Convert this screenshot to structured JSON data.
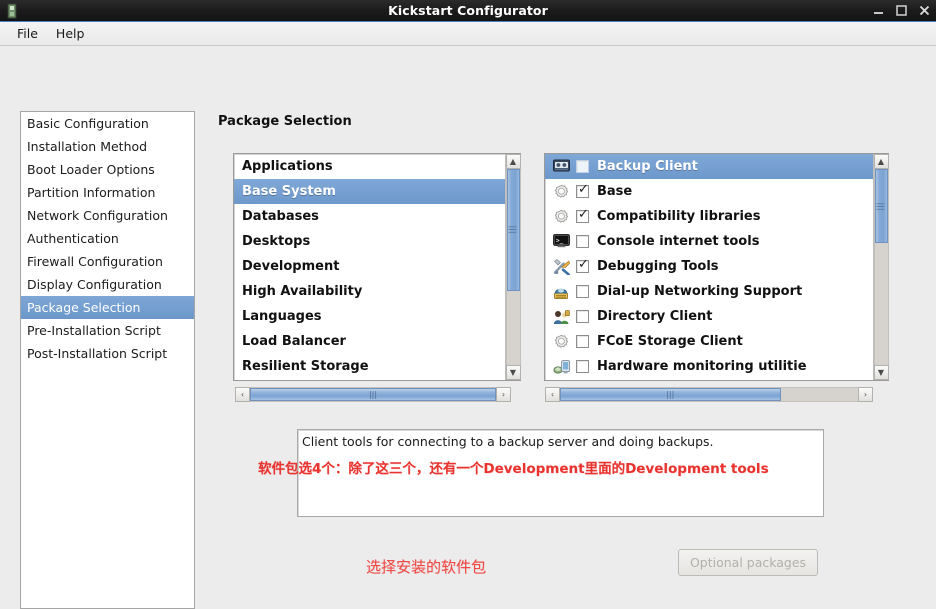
{
  "window": {
    "title": "Kickstart Configurator",
    "app_icon": "app-icon",
    "controls": {
      "minimize": "—",
      "maximize": "□",
      "close": "✕"
    }
  },
  "menubar": {
    "items": [
      {
        "label": "File"
      },
      {
        "label": "Help"
      }
    ]
  },
  "sidebar": {
    "items": [
      {
        "label": "Basic Configuration",
        "selected": false
      },
      {
        "label": "Installation Method",
        "selected": false
      },
      {
        "label": "Boot Loader Options",
        "selected": false
      },
      {
        "label": "Partition Information",
        "selected": false
      },
      {
        "label": "Network Configuration",
        "selected": false
      },
      {
        "label": "Authentication",
        "selected": false
      },
      {
        "label": "Firewall Configuration",
        "selected": false
      },
      {
        "label": "Display Configuration",
        "selected": false
      },
      {
        "label": "Package Selection",
        "selected": true
      },
      {
        "label": "Pre-Installation Script",
        "selected": false
      },
      {
        "label": "Post-Installation Script",
        "selected": false
      }
    ]
  },
  "main": {
    "page_title": "Package Selection",
    "groups": {
      "items": [
        {
          "label": "Applications",
          "selected": false
        },
        {
          "label": "Base System",
          "selected": true
        },
        {
          "label": "Databases",
          "selected": false
        },
        {
          "label": "Desktops",
          "selected": false
        },
        {
          "label": "Development",
          "selected": false
        },
        {
          "label": "High Availability",
          "selected": false
        },
        {
          "label": "Languages",
          "selected": false
        },
        {
          "label": "Load Balancer",
          "selected": false
        },
        {
          "label": "Resilient Storage",
          "selected": false
        }
      ],
      "vscroll": {
        "thumb_top_pct": 0,
        "thumb_height_pct": 62,
        "up_arrow": "▲",
        "down_arrow": "▼"
      },
      "hscroll": {
        "thumb_left_pct": 0,
        "thumb_width_pct": 100,
        "left_arrow": "‹",
        "right_arrow": "›"
      }
    },
    "packages": {
      "items": [
        {
          "label": "Backup Client",
          "checked": false,
          "selected": true,
          "icon": "tape-backup-icon"
        },
        {
          "label": "Base",
          "checked": true,
          "selected": false,
          "icon": "gear-icon"
        },
        {
          "label": "Compatibility libraries",
          "checked": true,
          "selected": false,
          "icon": "gear-icon"
        },
        {
          "label": "Console internet tools",
          "checked": false,
          "selected": false,
          "icon": "terminal-icon"
        },
        {
          "label": "Debugging Tools",
          "checked": true,
          "selected": false,
          "icon": "tools-icon"
        },
        {
          "label": "Dial-up Networking Support",
          "checked": false,
          "selected": false,
          "icon": "telephone-icon"
        },
        {
          "label": "Directory Client",
          "checked": false,
          "selected": false,
          "icon": "users-icon"
        },
        {
          "label": "FCoE Storage Client",
          "checked": false,
          "selected": false,
          "icon": "gear-icon"
        },
        {
          "label": "Hardware monitoring utilitie",
          "checked": false,
          "selected": false,
          "icon": "hardware-monitor-icon"
        }
      ],
      "vscroll": {
        "thumb_top_pct": 0,
        "thumb_height_pct": 38,
        "up_arrow": "▲",
        "down_arrow": "▼"
      },
      "hscroll": {
        "thumb_left_pct": 0,
        "thumb_width_pct": 74,
        "left_arrow": "‹",
        "right_arrow": "›"
      }
    },
    "description": "Client tools for connecting to a backup server and doing backups.",
    "optional_packages_button": "Optional packages"
  },
  "annotations": {
    "note_packages": "软件包选4个：除了这三个，还有一个Development里面的Development tools",
    "note_select": "选择安装的软件包",
    "color": "#e8332f"
  }
}
